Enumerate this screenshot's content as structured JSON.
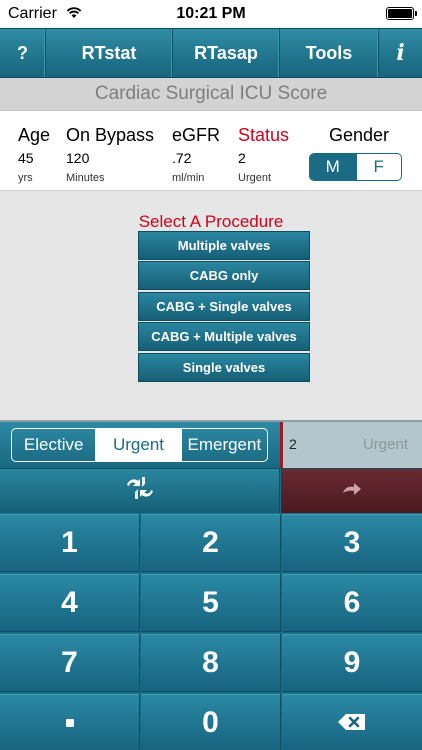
{
  "status_bar": {
    "carrier": "Carrier",
    "time": "10:21 PM"
  },
  "nav": {
    "help": "?",
    "rtstat": "RTstat",
    "rtasap": "RTasap",
    "tools": "Tools",
    "info": "i"
  },
  "title": "Cardiac Surgical ICU Score",
  "params": {
    "age": {
      "label": "Age",
      "value": "45",
      "unit": "yrs"
    },
    "bypass": {
      "label": "On Bypass",
      "value": "120",
      "unit": "Minutes"
    },
    "egfr": {
      "label": "eGFR",
      "value": ".72",
      "unit": "ml/min"
    },
    "status": {
      "label": "Status",
      "value": "2",
      "unit": "Urgent"
    },
    "gender": {
      "label": "Gender",
      "options": [
        "M",
        "F"
      ],
      "selected": "M"
    }
  },
  "procedure": {
    "title": "Select A Procedure",
    "options": [
      "Multiple valves",
      "CABG only",
      "CABG + Single valves",
      "CABG + Multiple valves",
      "Single valves"
    ]
  },
  "urgency": {
    "options": [
      "Elective",
      "Urgent",
      "Emergent"
    ],
    "selected": "Urgent"
  },
  "display": {
    "number": "2",
    "text": "Urgent"
  },
  "keys": [
    "1",
    "2",
    "3",
    "4",
    "5",
    "6",
    "7",
    "8",
    "9",
    ".",
    "0",
    "backspace"
  ],
  "colors": {
    "accent": "#1b6b84",
    "status_red": "#d0021b",
    "next_button": "#5a2028"
  }
}
